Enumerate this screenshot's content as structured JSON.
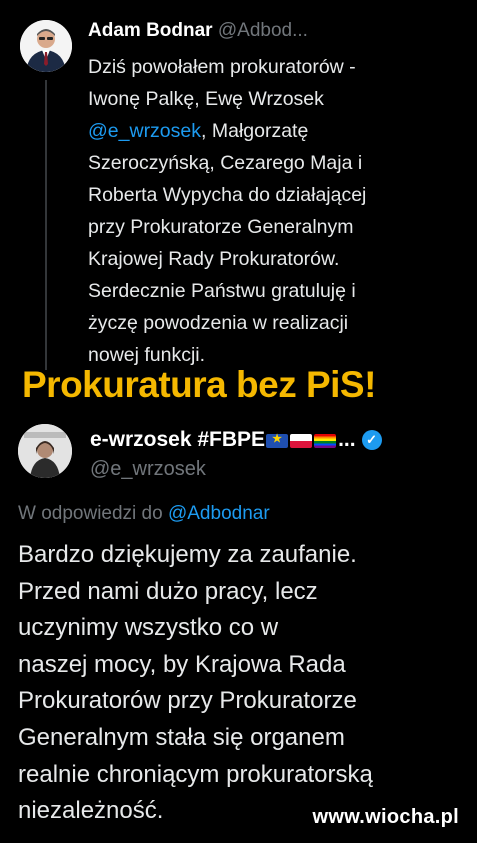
{
  "tweet1": {
    "author_name": "Adam Bodnar",
    "author_handle": "@Adbod...",
    "text_before_mention": "Dziś powołałem prokuratorów -\nIwonę Palkę, Ewę Wrzosek\n",
    "mention": "@e_wrzosek",
    "text_after_mention": ", Małgorzatę\nSzeroczyńską, Cezarego Maja i\nRoberta Wypycha do działającej\nprzy Prokuratorze Generalnym\nKrajowej Rady Prokuratorów.\nSerdecznie Państwu gratuluję i\nżyczę powodzenia w realizacji\nnowej funkcji."
  },
  "headline": "Prokuratura bez PiS!",
  "tweet2": {
    "author_name": "e-wrzosek #FBPE",
    "name_suffix": "...",
    "author_handle": "@e_wrzosek",
    "verified_icon": "check",
    "reply_prefix": "W odpowiedzi do ",
    "reply_mention": "@Adbodnar",
    "text": "Bardzo dziękujemy za zaufanie.\nPrzed nami dużo pracy, lecz\nuczynimy  wszystko co w\nnaszej mocy, by Krajowa Rada\nProkuratorów przy Prokuratorze\nGeneralnym stała się organem\nrealnie chroniącym prokuratorską\nniezależność."
  },
  "watermark": "www.wiocha.pl",
  "colors": {
    "background": "#000000",
    "link": "#1d9bf0",
    "headline": "#f5b800",
    "muted": "#71767b"
  }
}
